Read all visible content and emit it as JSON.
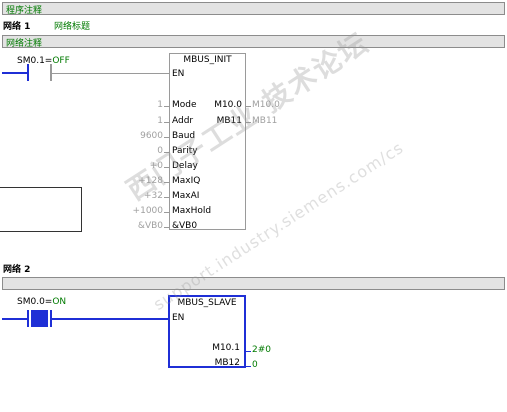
{
  "program_comment": "程序注释",
  "network1": {
    "label": "网络 1",
    "title": "网络标题",
    "comment": "网络注释",
    "contact": {
      "address": "SM0.1",
      "eq": "=",
      "state": "OFF"
    },
    "block": {
      "name": "MBUS_INIT",
      "en": "EN",
      "inputs": [
        {
          "value": "1",
          "pin": "Mode"
        },
        {
          "value": "1",
          "pin": "Addr"
        },
        {
          "value": "9600",
          "pin": "Baud"
        },
        {
          "value": "0",
          "pin": "Parity"
        },
        {
          "value": "+0",
          "pin": "Delay"
        },
        {
          "value": "+128",
          "pin": "MaxIQ"
        },
        {
          "value": "+32",
          "pin": "MaxAI"
        },
        {
          "value": "+1000",
          "pin": "MaxHold"
        },
        {
          "value": "&VB0",
          "pin": "&VB0"
        }
      ],
      "outputs": [
        {
          "pin": "M10.0",
          "value": "M10.0"
        },
        {
          "pin": "MB11",
          "value": "MB11"
        }
      ]
    }
  },
  "network2": {
    "label": "网络 2",
    "contact": {
      "address": "SM0.0",
      "eq": "=",
      "state": "ON"
    },
    "block": {
      "name": "MBUS_SLAVE",
      "en": "EN",
      "outputs": [
        {
          "pin": "M10.1",
          "value": "2#0"
        },
        {
          "pin": "MB12",
          "value": "0"
        }
      ]
    }
  },
  "watermark": {
    "line1": "西门子工业 技术论坛",
    "line2": "support.industry.siemens.com/cs"
  },
  "colors": {
    "energized": "#1f2fd6",
    "status_green": "#007a00",
    "wire_gray": "#9a9a9a"
  }
}
